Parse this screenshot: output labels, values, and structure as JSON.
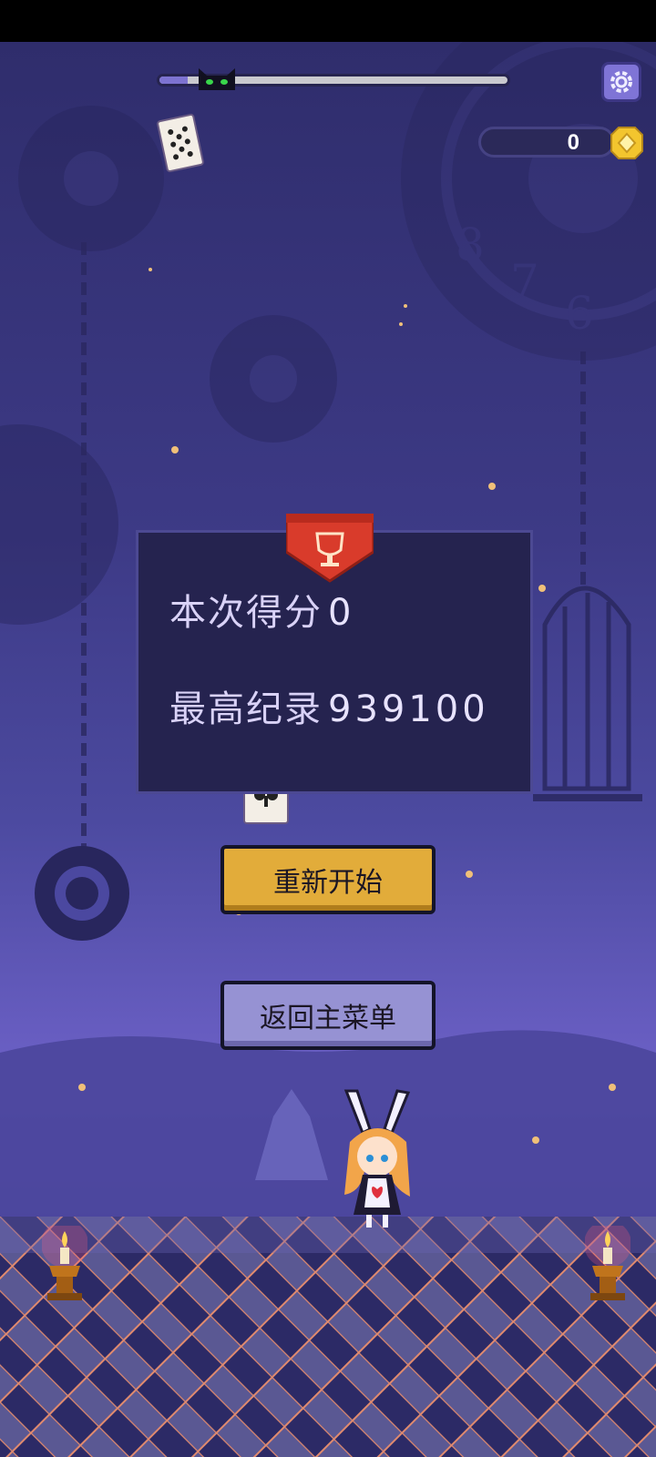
{
  "hud": {
    "progress_fraction": 0.08,
    "coins": "0",
    "settings_icon": "gear-icon",
    "coin_icon": "diamond-coin-icon"
  },
  "result_panel": {
    "icon": "trophy-icon",
    "current_score_label": "本次得分",
    "current_score_value": "0",
    "best_score_label": "最高纪录",
    "best_score_value": "939100"
  },
  "buttons": {
    "restart_label": "重新开始",
    "main_menu_label": "返回主菜单"
  },
  "colors": {
    "restart_button": "#e2ac3a",
    "menu_button": "#9692d3",
    "panel": "#25234f",
    "banner": "#d93b2b"
  }
}
